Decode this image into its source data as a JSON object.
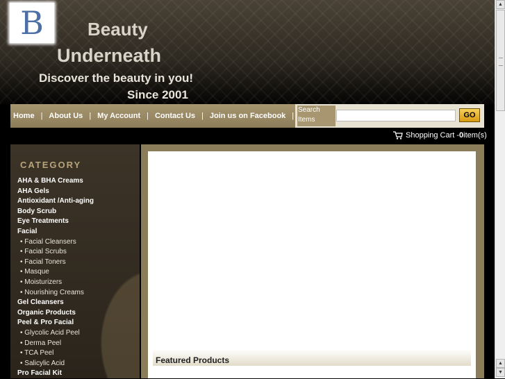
{
  "header": {
    "logo_letter": "B",
    "title_line1": "Beauty",
    "title_line2": "Underneath",
    "tagline": "Discover the beauty in you!",
    "since": "Since 2001"
  },
  "nav": {
    "links": [
      "Home",
      "About Us",
      "My Account",
      "Contact Us",
      "Join us on Facebook"
    ],
    "separator": "|"
  },
  "search": {
    "label": "Search Items",
    "value": "",
    "placeholder": "",
    "go_label": "GO"
  },
  "cart": {
    "icon": "shopping-cart-icon",
    "label": "Shopping Cart - ",
    "count": "0",
    "suffix": " item(s)"
  },
  "sidebar": {
    "title": "CATEGORY",
    "items": [
      {
        "label": "AHA & BHA Creams",
        "level": "main"
      },
      {
        "label": "AHA Gels",
        "level": "main"
      },
      {
        "label": "Antioxidant /Anti-aging",
        "level": "main"
      },
      {
        "label": "Body Scrub",
        "level": "main"
      },
      {
        "label": "Eye Treatments",
        "level": "main"
      },
      {
        "label": "Facial",
        "level": "main"
      },
      {
        "label": "• Facial Cleansers",
        "level": "sub"
      },
      {
        "label": "• Facial Scrubs",
        "level": "sub"
      },
      {
        "label": "• Facial Toners",
        "level": "sub"
      },
      {
        "label": "• Masque",
        "level": "sub"
      },
      {
        "label": "• Moisturizers",
        "level": "sub"
      },
      {
        "label": "• Nourishing Creams",
        "level": "sub"
      },
      {
        "label": "Gel Cleansers",
        "level": "main"
      },
      {
        "label": "Organic Products",
        "level": "main"
      },
      {
        "label": "Peel & Pro Facial",
        "level": "main"
      },
      {
        "label": "• Glycolic Acid Peel",
        "level": "sub"
      },
      {
        "label": "• Derma Peel",
        "level": "sub"
      },
      {
        "label": "• TCA Peel",
        "level": "sub"
      },
      {
        "label": "• Salicylic Acid",
        "level": "sub"
      },
      {
        "label": "Pro Facial Kit",
        "level": "main"
      }
    ]
  },
  "main": {
    "featured_title": "Featured Products"
  },
  "colors": {
    "nav_bg": "#a7966f",
    "go_button": "#e8b026",
    "category_title": "#b7a47a",
    "logo_letter": "#4d6fa6"
  }
}
